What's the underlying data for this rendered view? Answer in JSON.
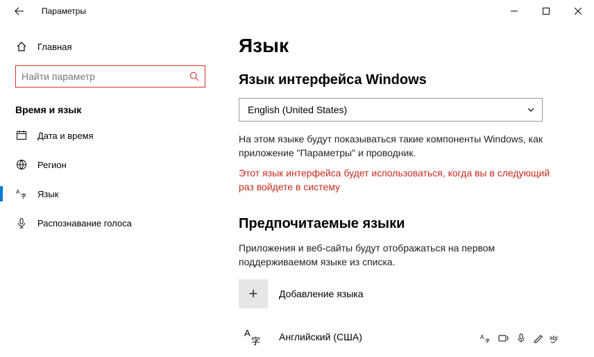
{
  "titlebar": {
    "title": "Параметры"
  },
  "sidebar": {
    "home_label": "Главная",
    "search_placeholder": "Найти параметр",
    "search_value": "",
    "section_title": "Время и язык",
    "items": [
      {
        "label": "Дата и время"
      },
      {
        "label": "Регион"
      },
      {
        "label": "Язык"
      },
      {
        "label": "Распознавание голоса"
      }
    ]
  },
  "main": {
    "heading": "Язык",
    "display_lang_heading": "Язык интерфейса Windows",
    "dropdown_value": "English (United States)",
    "display_lang_desc": "На этом языке будут показываться такие компоненты Windows, как приложение \"Параметры\" и проводник.",
    "display_lang_warn": "Этот язык интерфейса будет использоваться, когда вы в следующий раз войдете в систему",
    "preferred_heading": "Предпочитаемые языки",
    "preferred_desc": "Приложения и веб-сайты будут отображаться на первом поддерживаемом языке из списка.",
    "add_lang_label": "Добавление языка",
    "lang_item_label": "Английский (США)"
  }
}
